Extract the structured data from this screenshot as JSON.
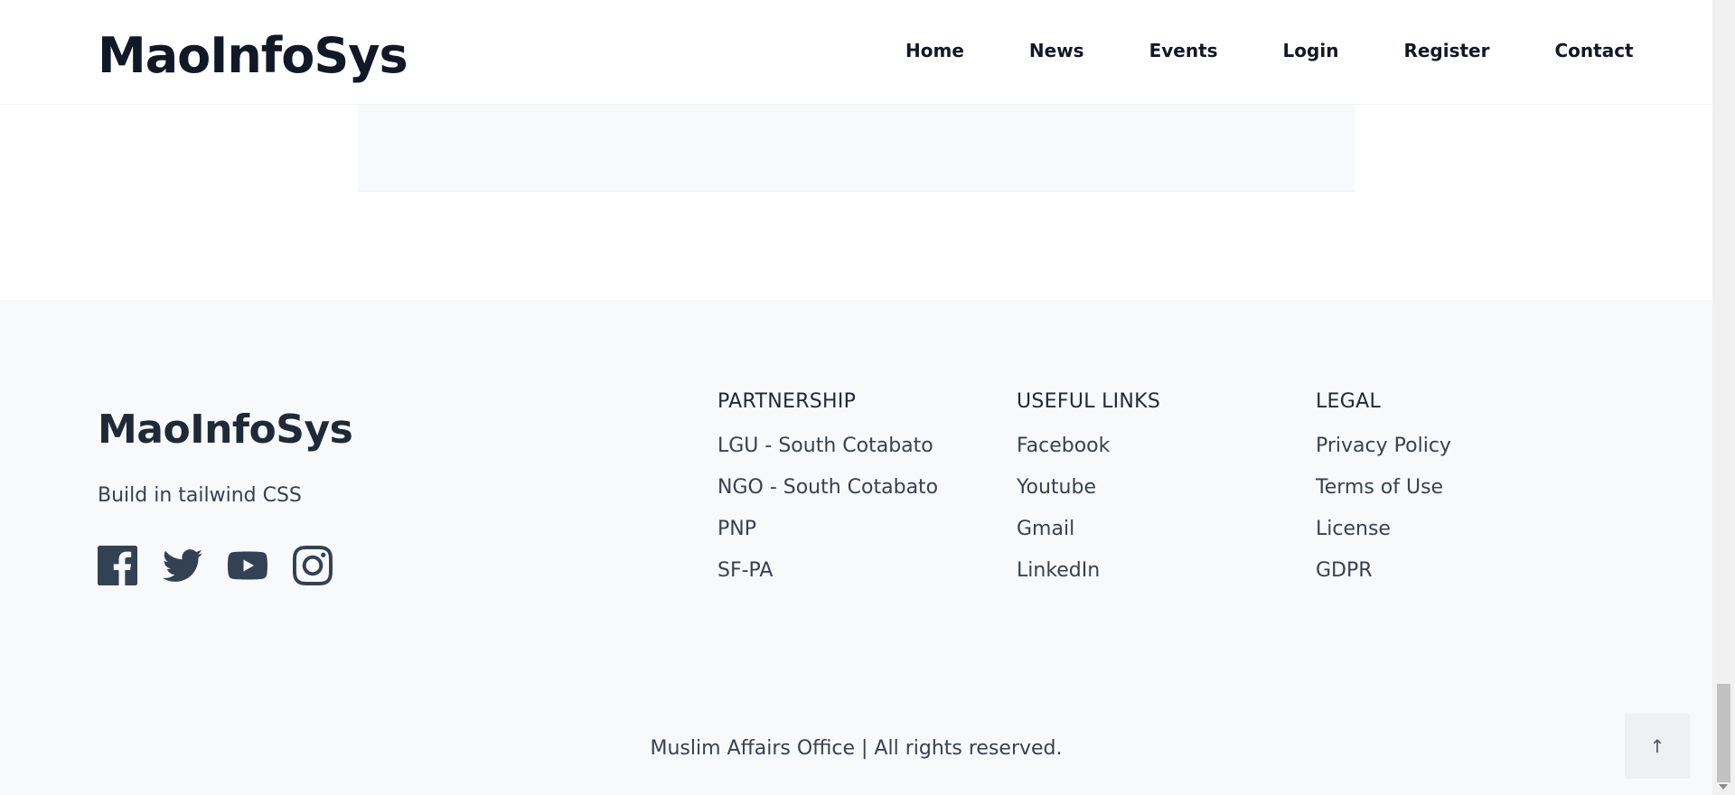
{
  "header": {
    "logo": "MaoInfoSys",
    "nav": [
      "Home",
      "News",
      "Events",
      "Login",
      "Register",
      "Contact"
    ]
  },
  "footer": {
    "logo": "MaoInfoSys",
    "tagline": "Build in tailwind CSS",
    "socials": [
      {
        "icon": "facebook-icon"
      },
      {
        "icon": "twitter-icon"
      },
      {
        "icon": "youtube-icon"
      },
      {
        "icon": "instagram-icon"
      }
    ],
    "columns": [
      {
        "title": "PARTNERSHIP",
        "links": [
          "LGU - South Cotabato",
          "NGO - South Cotabato",
          "PNP",
          "SF-PA"
        ]
      },
      {
        "title": "USEFUL LINKS",
        "links": [
          "Facebook",
          "Youtube",
          "Gmail",
          "LinkedIn"
        ]
      },
      {
        "title": "LEGAL",
        "links": [
          "Privacy Policy",
          "Terms of Use",
          "License",
          "GDPR"
        ]
      }
    ],
    "copyright": "Muslim Affairs Office | All rights reserved.",
    "back_to_top": "↑"
  },
  "colors": {
    "text_dark": "#111827",
    "footer_bg": "#f8f9fa",
    "icon": "#334155"
  }
}
